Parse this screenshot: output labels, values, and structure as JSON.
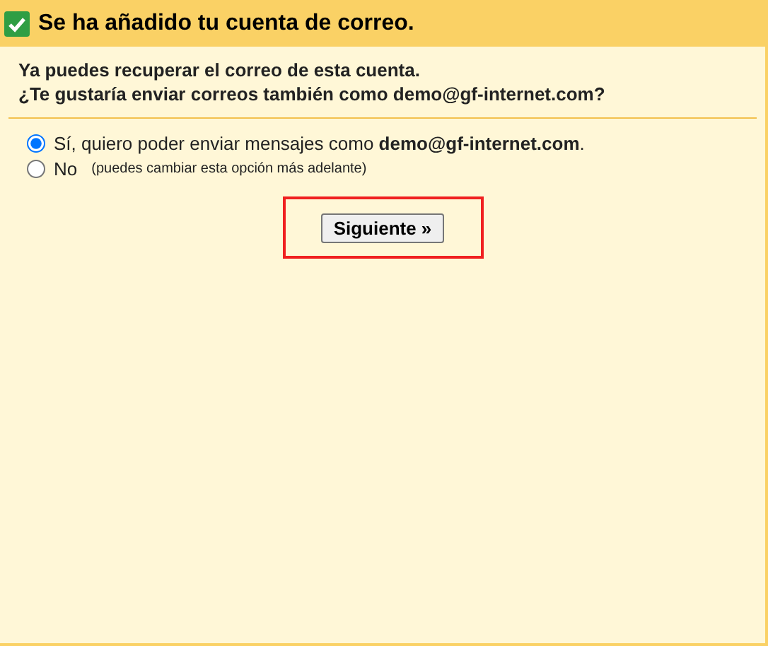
{
  "header": {
    "title": "Se ha añadido tu cuenta de correo.",
    "checked": true
  },
  "intro": [
    "Ya puedes recuperar el correo de esta cuenta.",
    "¿Te gustaría enviar correos también como demo@gf-internet.com?"
  ],
  "options": [
    {
      "label": "Sí, quiero poder enviar mensajes como **demo@gf-internet.com**.",
      "selected": true
    },
    {
      "label": "No",
      "note": "(puedes cambiar esta opción más adelante)",
      "selected": false
    }
  ],
  "next_button": {
    "label": "Siguiente »"
  }
}
